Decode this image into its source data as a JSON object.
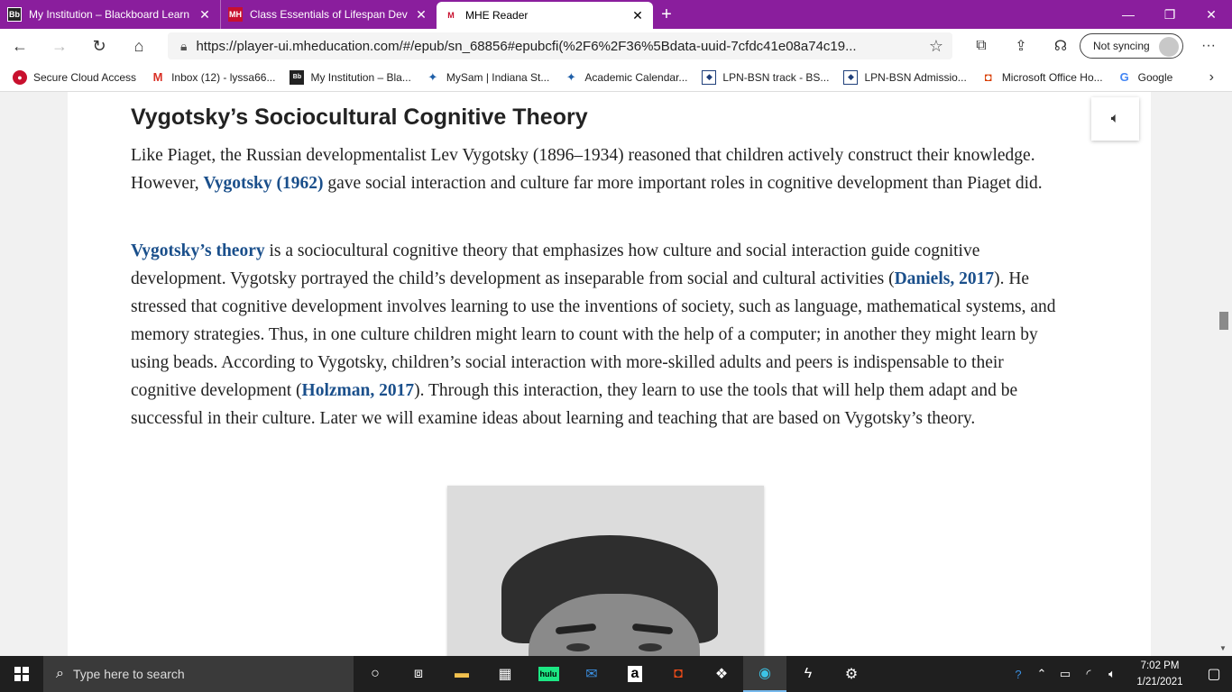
{
  "tabs": [
    {
      "icon": "Bb",
      "title": "My Institution – Blackboard Learn",
      "close": "✕"
    },
    {
      "icon": "MH",
      "title": "Class Essentials of Lifespan Development",
      "close": "✕"
    },
    {
      "icon": "M",
      "title": "MHE Reader",
      "close": "✕"
    }
  ],
  "new_tab": "+",
  "window_controls": {
    "minimize": "—",
    "restore": "❐",
    "close": "✕"
  },
  "address": {
    "url": "https://player-ui.mheducation.com/#/epub/sn_68856#epubcfi(%2F6%2F36%5Bdata-uuid-7cfdc41e08a74c19...",
    "sync_label": "Not syncing"
  },
  "favorites": [
    {
      "icon": "●",
      "label": "Secure Cloud Access"
    },
    {
      "icon": "M",
      "label": "Inbox (12) - lyssa66..."
    },
    {
      "icon": "Bb",
      "label": "My Institution – Bla..."
    },
    {
      "icon": "✦",
      "label": "MySam | Indiana St..."
    },
    {
      "icon": "✦",
      "label": "Academic Calendar..."
    },
    {
      "icon": "◆",
      "label": "LPN-BSN track - BS..."
    },
    {
      "icon": "◆",
      "label": "LPN-BSN Admissio..."
    },
    {
      "icon": "◘",
      "label": "Microsoft Office Ho..."
    },
    {
      "icon": "G",
      "label": "Google"
    }
  ],
  "favorites_more": "›",
  "article": {
    "heading": "Vygotsky’s Sociocultural Cognitive Theory",
    "p1": {
      "a": "Like Piaget, the Russian developmentalist Lev Vygotsky (1896–1934) reasoned that children actively construct their knowledge. However, ",
      "link1": "Vygotsky (1962)",
      "b": " gave social interaction and culture far more important roles in cognitive development than Piaget did."
    },
    "p2": {
      "link1": "Vygotsky’s theory",
      "a": " is a sociocultural cognitive theory that emphasizes how culture and social interaction guide cognitive development. Vygotsky portrayed the child’s development as inseparable from social and cultural activities (",
      "link2": "Daniels, 2017",
      "b": "). He stressed that cognitive development involves learning to use the inventions of society, such as language, mathematical systems, and memory strategies. Thus, in one culture children might learn to count with the help of a computer; in another they might learn by using beads. According to Vygotsky, children’s social interaction with more-skilled adults and peers is indispensable to their cognitive development (",
      "link3": "Holzman, 2017",
      "c": "). Through this interaction, they learn to use the tools that will help them adapt and be successful in their culture. Later we will examine ideas about learning and teaching that are based on Vygotsky’s theory."
    }
  },
  "taskbar": {
    "search_placeholder": "Type here to search",
    "time": "7:02 PM",
    "date": "1/21/2021",
    "hulu_label": "hulu",
    "amazon_label": "a"
  },
  "colors": {
    "tab_strip": "#8a1e9d",
    "link": "#1a4f8b",
    "taskbar": "#1f1f1f"
  }
}
